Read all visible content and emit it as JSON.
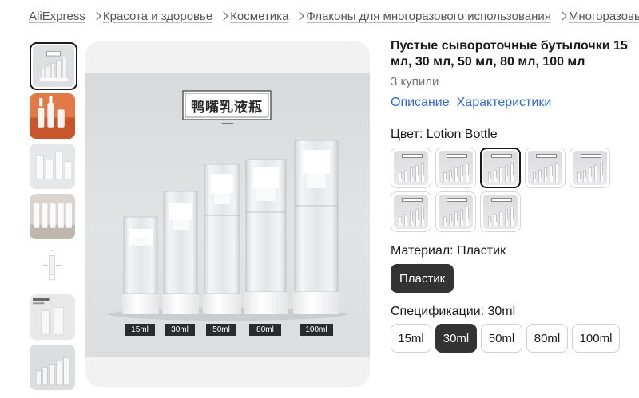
{
  "breadcrumb": [
    "AliExpress",
    "Красота и здоровье",
    "Косметика",
    "Флаконы для многоразового использования",
    "Многоразовые"
  ],
  "gallery": {
    "thumbnail_count": 7,
    "selected_index": 0,
    "main_image": {
      "chinese_title": "鸭嘴乳液瓶",
      "bottle_labels": [
        "15ml",
        "30ml",
        "50ml",
        "80ml",
        "100ml"
      ]
    }
  },
  "product": {
    "title": "Пустые сывороточные бутылочки 15 мл, 30 мл, 50 мл, 80 мл, 100 мл",
    "sold": "3 купили"
  },
  "tabs": [
    "Описание",
    "Характеристики"
  ],
  "color": {
    "label": "Цвет: Lotion Bottle",
    "swatch_count": 8,
    "selected_index": 2
  },
  "material": {
    "label": "Материал: Пластик",
    "options": [
      "Пластик"
    ],
    "selected_index": 0
  },
  "specs": {
    "label": "Спецификации: 30ml",
    "options": [
      "15ml",
      "30ml",
      "50ml",
      "80ml",
      "100ml"
    ],
    "selected_index": 1
  },
  "colors": {
    "text": "#191919",
    "muted": "#757575",
    "link": "#2e6ad8",
    "selected_pill": "#333333",
    "border": "#d6d6d6"
  }
}
